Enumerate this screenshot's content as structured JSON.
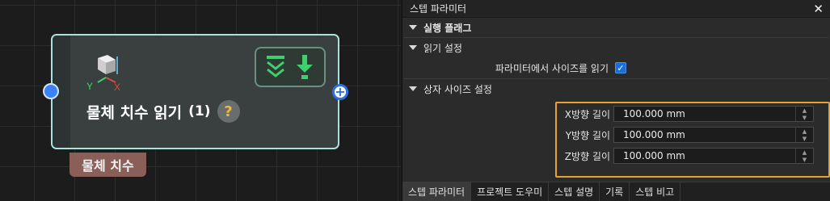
{
  "node": {
    "title": "물체 치수 읽기",
    "count": "(1)",
    "help_glyph": "?",
    "output_label": "물체 치수",
    "axis_labels": {
      "y": "Y",
      "x": "X"
    },
    "icons": [
      "cube-axes-icon",
      "collapse-chevron-icon",
      "download-arrow-icon",
      "help-icon"
    ],
    "colors": {
      "border": "#a9e3dc",
      "accent_green": "#3dd16b",
      "input_port": "#3b82f6",
      "output_tag": "#8a5f57"
    }
  },
  "panel": {
    "title": "스텝 파라미터",
    "close_glyph": "✕",
    "sections": {
      "run_flag": "실행 플래그",
      "read_settings": "읽기 설정",
      "box_size": "상자 사이즈 설정"
    },
    "read_from_params": {
      "label": "파라미터에서 사이즈를 읽기",
      "checked": true,
      "check_glyph": "✓"
    },
    "fields": [
      {
        "label": "X방향 길이",
        "value": "100.000 mm"
      },
      {
        "label": "Y방향 길이",
        "value": "100.000 mm"
      },
      {
        "label": "Z방향 길이",
        "value": "100.000 mm"
      }
    ],
    "spin_up": "▲",
    "spin_down": "▼",
    "highlight_color": "#e8a033"
  },
  "tabs": [
    {
      "label": "스텝 파라미터",
      "active": true
    },
    {
      "label": "프로젝트 도우미",
      "active": false
    },
    {
      "label": "스텝 설명",
      "active": false
    },
    {
      "label": "기록",
      "active": false
    },
    {
      "label": "스텝 비고",
      "active": false
    }
  ]
}
